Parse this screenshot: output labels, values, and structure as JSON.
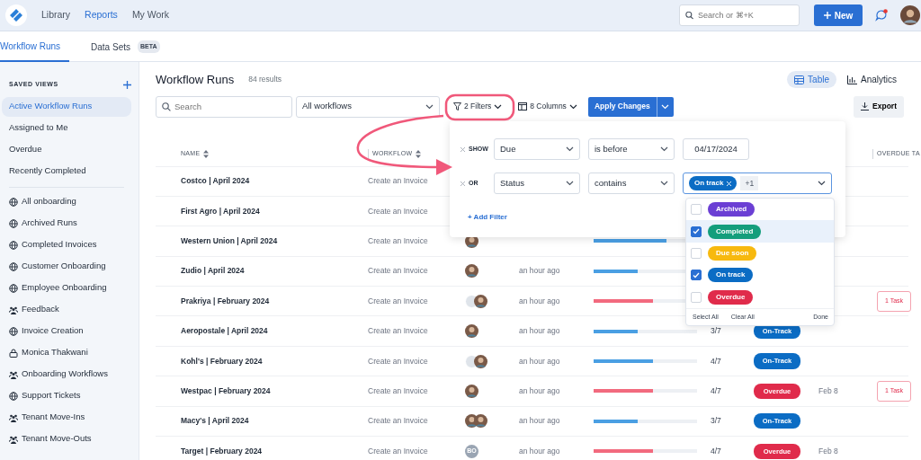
{
  "nav": {
    "links": [
      {
        "label": "Library",
        "selected": false
      },
      {
        "label": "Reports",
        "selected": true
      },
      {
        "label": "My Work",
        "selected": false
      }
    ],
    "search": {
      "placeholder": "Search or ⌘+K"
    },
    "new_button": "New",
    "chat_unread": true
  },
  "tabs": [
    {
      "label": "Workflow Runs",
      "selected": true
    },
    {
      "label": "Data Sets",
      "badge": "BETA",
      "selected": false
    }
  ],
  "sidebar": {
    "heading": "SAVED VIEWS",
    "views": [
      {
        "label": "Active Workflow Runs",
        "selected": true
      },
      {
        "label": "Assigned to Me",
        "selected": false
      },
      {
        "label": "Overdue",
        "selected": false
      },
      {
        "label": "Recently Completed",
        "selected": false
      }
    ],
    "shared": [
      {
        "label": "All onboarding",
        "kind": "globe"
      },
      {
        "label": "Archived Runs",
        "kind": "globe"
      },
      {
        "label": "Completed Invoices",
        "kind": "globe"
      },
      {
        "label": "Customer Onboarding",
        "kind": "globe"
      },
      {
        "label": "Employee Onboarding",
        "kind": "globe"
      },
      {
        "label": "Feedback",
        "kind": "team"
      },
      {
        "label": "Invoice Creation",
        "kind": "globe"
      },
      {
        "label": "Monica Thakwani",
        "kind": "lock"
      },
      {
        "label": "Onboarding Workflows",
        "kind": "team"
      },
      {
        "label": "Support Tickets",
        "kind": "globe"
      },
      {
        "label": "Tenant Move-Ins",
        "kind": "team"
      },
      {
        "label": "Tenant Move-Outs",
        "kind": "team"
      }
    ]
  },
  "page": {
    "title": "Workflow Runs",
    "count": "84 results",
    "views": [
      {
        "label": "Table",
        "kind": "table",
        "selected": true
      },
      {
        "label": "Analytics",
        "kind": "chart",
        "selected": false
      }
    ]
  },
  "toolbar": {
    "search": {
      "placeholder": "Search"
    },
    "workflow_select": "All workflows",
    "filters": "2 Filters",
    "columns": "8 Columns",
    "apply": "Apply Changes",
    "export": "Export"
  },
  "table": {
    "columns": [
      {
        "label": "NAME",
        "sortable": true
      },
      {
        "label": "WORKFLOW",
        "sortable": true
      },
      {
        "label": "OVERDUE TA"
      }
    ],
    "rows": [
      {
        "name": "Costco | April 2024",
        "workflow": "Create an Invoice"
      },
      {
        "name": "First Agro | April 2024",
        "workflow": "Create an Invoice"
      },
      {
        "name": "Western Union | April 2024",
        "workflow": "Create an Invoice",
        "avatars": [
          {
            "kind": "photo"
          }
        ],
        "progress": {
          "level": 0.7,
          "color": "#4a9fe3"
        }
      },
      {
        "name": "Zudio | April 2024",
        "workflow": "Create an Invoice",
        "avatars": [
          {
            "kind": "photo"
          }
        ],
        "updated": "an hour ago",
        "progress": {
          "level": 0.43,
          "color": "#4a9fe3"
        }
      },
      {
        "name": "Prakriya | February 2024",
        "workflow": "Create an Invoice",
        "avatars": [
          {
            "kind": "blank"
          },
          {
            "kind": "photo"
          }
        ],
        "updated": "an hour ago",
        "progress": {
          "level": 0.57,
          "color": "#f26a7e"
        },
        "overdue": "1 Task"
      },
      {
        "name": "Aeropostale | April 2024",
        "workflow": "Create an Invoice",
        "avatars": [
          {
            "kind": "photo"
          }
        ],
        "updated": "an hour ago",
        "progress": {
          "level": 0.43,
          "color": "#4a9fe3"
        },
        "steps": "3/7",
        "status": {
          "label": "On-Track",
          "color": "#0b6cc4"
        }
      },
      {
        "name": "Kohl's | February 2024",
        "workflow": "Create an Invoice",
        "avatars": [
          {
            "kind": "blank"
          },
          {
            "kind": "photo"
          }
        ],
        "updated": "an hour ago",
        "progress": {
          "level": 0.57,
          "color": "#4a9fe3"
        },
        "steps": "4/7",
        "status": {
          "label": "On-Track",
          "color": "#0b6cc4"
        }
      },
      {
        "name": "Westpac | February 2024",
        "workflow": "Create an Invoice",
        "avatars": [
          {
            "kind": "photo"
          }
        ],
        "updated": "an hour ago",
        "progress": {
          "level": 0.57,
          "color": "#f26a7e"
        },
        "steps": "4/7",
        "status": {
          "label": "Overdue",
          "color": "#e02b4b"
        },
        "due": "Feb 8",
        "overdue": "1 Task"
      },
      {
        "name": "Macy's | April 2024",
        "workflow": "Create an Invoice",
        "avatars": [
          {
            "kind": "photo"
          },
          {
            "kind": "photo"
          }
        ],
        "updated": "an hour ago",
        "progress": {
          "level": 0.43,
          "color": "#4a9fe3"
        },
        "steps": "3/7",
        "status": {
          "label": "On-Track",
          "color": "#0b6cc4"
        }
      },
      {
        "name": "Target | February 2024",
        "workflow": "Create an Invoice",
        "avatars": [
          {
            "kind": "initials",
            "text": "BO"
          }
        ],
        "updated": "an hour ago",
        "progress": {
          "level": 0.57,
          "color": "#f26a7e"
        },
        "steps": "4/7",
        "status": {
          "label": "Overdue",
          "color": "#e02b4b"
        },
        "due": "Feb 8"
      }
    ]
  },
  "filter_panel": {
    "rows": [
      {
        "connector": "SHOW",
        "field": "Due",
        "operator": "is before",
        "value": {
          "kind": "date",
          "text": "04/17/2024"
        }
      },
      {
        "connector": "OR",
        "field": "Status",
        "operator": "contains",
        "value": {
          "kind": "tags",
          "tags": [
            {
              "label": "On track",
              "color": "#0b6cc4"
            }
          ],
          "more": "+1"
        }
      }
    ],
    "add_filter": "+ Add Filter"
  },
  "status_menu": {
    "options": [
      {
        "label": "Archived",
        "color": "#6b3fd4",
        "checked": false,
        "selected": false
      },
      {
        "label": "Completed",
        "color": "#149e7c",
        "checked": true,
        "selected": true
      },
      {
        "label": "Due soon",
        "color": "#f7b90f",
        "checked": false,
        "selected": false
      },
      {
        "label": "On track",
        "color": "#0b6cc4",
        "checked": true,
        "selected": false
      },
      {
        "label": "Overdue",
        "color": "#e02b4b",
        "checked": false,
        "selected": false
      }
    ],
    "select_all": "Select All",
    "clear_all": "Clear All",
    "done": "Done"
  }
}
